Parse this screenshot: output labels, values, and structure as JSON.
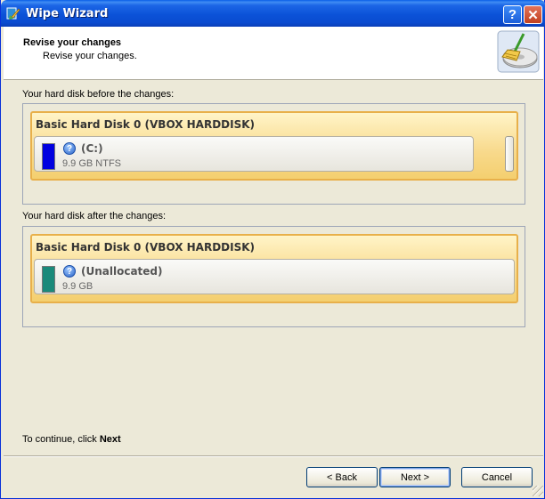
{
  "window": {
    "title": "Wipe Wizard",
    "help_label": "?",
    "close_label": "✕"
  },
  "header": {
    "title": "Revise your changes",
    "subtitle": "Revise your changes.",
    "icon": "disk-broom-icon"
  },
  "before": {
    "label": "Your hard disk before the changes:",
    "disk_title": "Basic Hard Disk 0 (VBOX HARDDISK)",
    "partition": {
      "name": "(C:)",
      "size": "9.9 GB NTFS",
      "color": "#0000e0"
    }
  },
  "after": {
    "label": "Your hard disk after the changes:",
    "disk_title": "Basic Hard Disk 0 (VBOX HARDDISK)",
    "partition": {
      "name": "(Unallocated)",
      "size": "9.9 GB",
      "color": "#1a8a7a"
    }
  },
  "footer": {
    "text": "To continue, click ",
    "bold": "Next"
  },
  "buttons": {
    "back": "< Back",
    "next": "Next >",
    "cancel": "Cancel"
  },
  "colors": {
    "titlebar": "#0b52d8",
    "disk_panel": "#f8d98b",
    "dialog_bg": "#ece9d8"
  }
}
